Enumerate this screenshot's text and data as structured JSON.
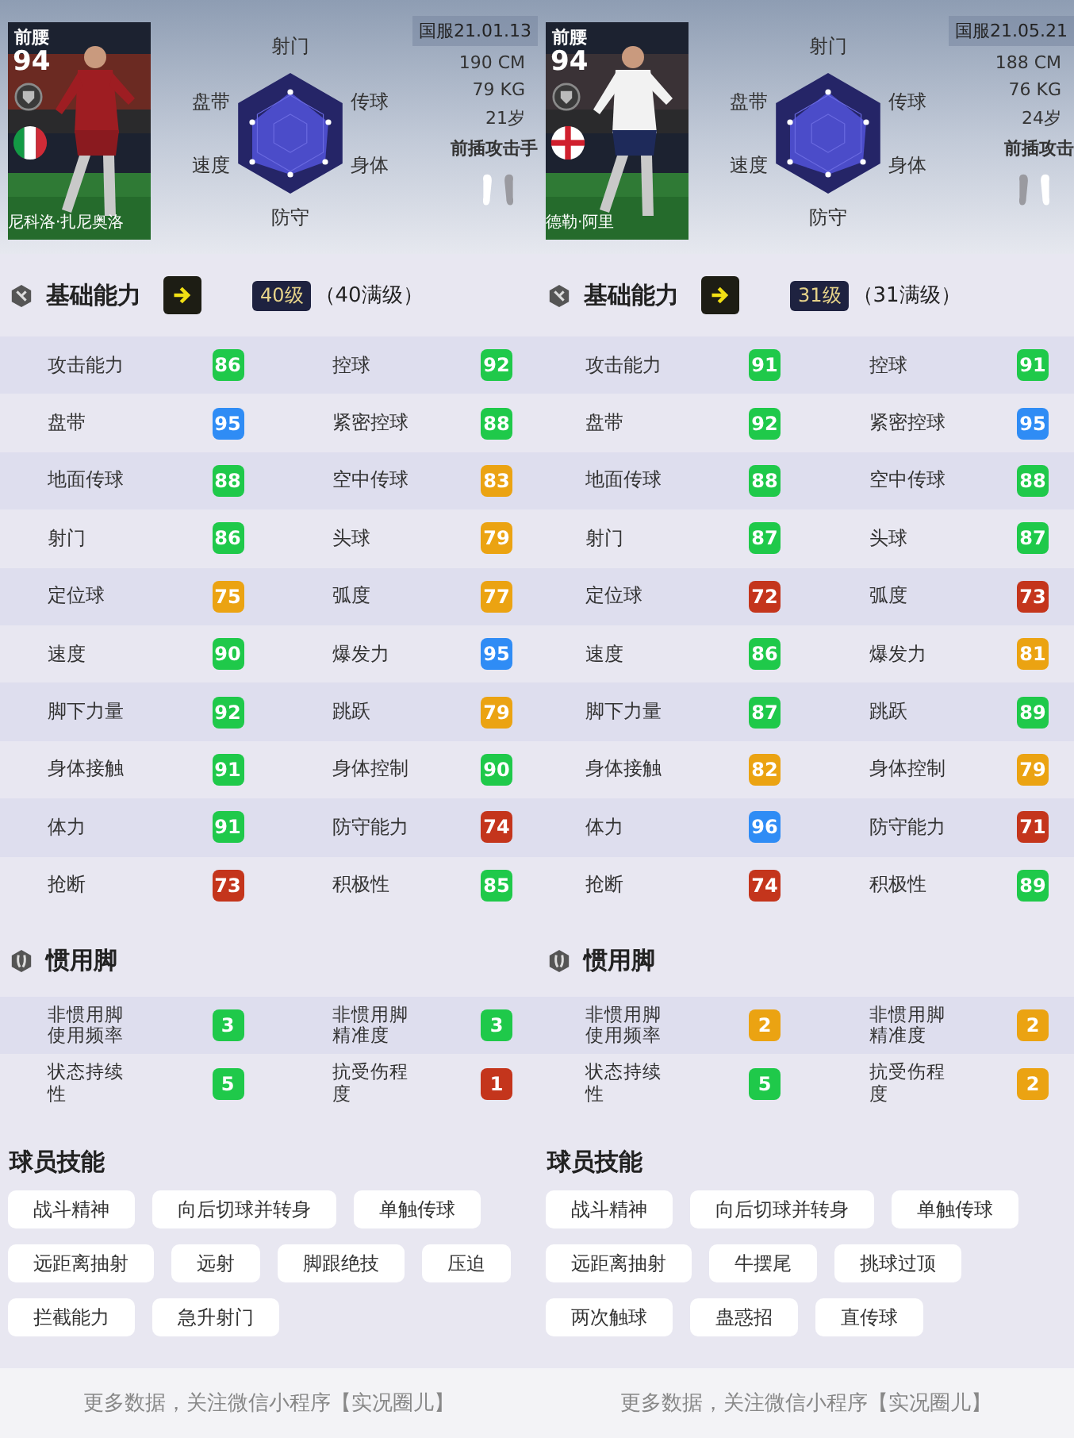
{
  "players": [
    {
      "position": "前腰",
      "rating": "94",
      "name": "尼科洛·扎尼奥洛",
      "flag": {
        "kind": "tricolor"
      },
      "server_date": "国服21.01.13",
      "height": "190 CM",
      "weight": "79 KG",
      "age": "21岁",
      "style": "前插攻击手",
      "feet": {
        "left_strong": true,
        "right_strong": false
      },
      "radar_labels": [
        "射门",
        "盘带",
        "传球",
        "速度",
        "身体",
        "防守"
      ],
      "section_title": "基础能力",
      "grade_badge": "40级",
      "grade_note": "（40满级）",
      "attributes": [
        {
          "label": "攻击能力",
          "value": "86",
          "color": "#1fc94a"
        },
        {
          "label": "控球",
          "value": "92",
          "color": "#1fc94a"
        },
        {
          "label": "盘带",
          "value": "95",
          "color": "#2f8cf5"
        },
        {
          "label": "紧密控球",
          "value": "88",
          "color": "#1fc94a"
        },
        {
          "label": "地面传球",
          "value": "88",
          "color": "#1fc94a"
        },
        {
          "label": "空中传球",
          "value": "83",
          "color": "#eba312"
        },
        {
          "label": "射门",
          "value": "86",
          "color": "#1fc94a"
        },
        {
          "label": "头球",
          "value": "79",
          "color": "#eba312"
        },
        {
          "label": "定位球",
          "value": "75",
          "color": "#eba312"
        },
        {
          "label": "弧度",
          "value": "77",
          "color": "#eba312"
        },
        {
          "label": "速度",
          "value": "90",
          "color": "#1fc94a"
        },
        {
          "label": "爆发力",
          "value": "95",
          "color": "#2f8cf5"
        },
        {
          "label": "脚下力量",
          "value": "92",
          "color": "#1fc94a"
        },
        {
          "label": "跳跃",
          "value": "79",
          "color": "#eba312"
        },
        {
          "label": "身体接触",
          "value": "91",
          "color": "#1fc94a"
        },
        {
          "label": "身体控制",
          "value": "90",
          "color": "#1fc94a"
        },
        {
          "label": "体力",
          "value": "91",
          "color": "#1fc94a"
        },
        {
          "label": "防守能力",
          "value": "74",
          "color": "#c4351c"
        },
        {
          "label": "抢断",
          "value": "73",
          "color": "#c4351c"
        },
        {
          "label": "积极性",
          "value": "85",
          "color": "#1fc94a"
        }
      ],
      "foot_title": "惯用脚",
      "foot_stats": [
        {
          "label": "非惯用脚使用频率",
          "value": "3",
          "color": "#1fc94a"
        },
        {
          "label": "非惯用脚精准度",
          "value": "3",
          "color": "#1fc94a"
        },
        {
          "label": "状态持续性",
          "value": "5",
          "color": "#1fc94a"
        },
        {
          "label": "抗受伤程度",
          "value": "1",
          "color": "#c4351c"
        }
      ],
      "skills_title": "球员技能",
      "skills": [
        "战斗精神",
        "向后切球并转身",
        "单触传球",
        "远距离抽射",
        "远射",
        "脚跟绝技",
        "压迫",
        "拦截能力",
        "急升射门"
      ],
      "footer": "更多数据，关注微信小程序【实况圈儿】"
    },
    {
      "position": "前腰",
      "rating": "94",
      "name": "德勒·阿里",
      "flag": {
        "kind": "cross"
      },
      "server_date": "国服21.05.21",
      "height": "188 CM",
      "weight": "76 KG",
      "age": "24岁",
      "style": "前插攻击",
      "feet": {
        "left_strong": false,
        "right_strong": true
      },
      "radar_labels": [
        "射门",
        "盘带",
        "传球",
        "速度",
        "身体",
        "防守"
      ],
      "section_title": "基础能力",
      "grade_badge": "31级",
      "grade_note": "（31满级）",
      "attributes": [
        {
          "label": "攻击能力",
          "value": "91",
          "color": "#1fc94a"
        },
        {
          "label": "控球",
          "value": "91",
          "color": "#1fc94a"
        },
        {
          "label": "盘带",
          "value": "92",
          "color": "#1fc94a"
        },
        {
          "label": "紧密控球",
          "value": "95",
          "color": "#2f8cf5"
        },
        {
          "label": "地面传球",
          "value": "88",
          "color": "#1fc94a"
        },
        {
          "label": "空中传球",
          "value": "88",
          "color": "#1fc94a"
        },
        {
          "label": "射门",
          "value": "87",
          "color": "#1fc94a"
        },
        {
          "label": "头球",
          "value": "87",
          "color": "#1fc94a"
        },
        {
          "label": "定位球",
          "value": "72",
          "color": "#c4351c"
        },
        {
          "label": "弧度",
          "value": "73",
          "color": "#c4351c"
        },
        {
          "label": "速度",
          "value": "86",
          "color": "#1fc94a"
        },
        {
          "label": "爆发力",
          "value": "81",
          "color": "#eba312"
        },
        {
          "label": "脚下力量",
          "value": "87",
          "color": "#1fc94a"
        },
        {
          "label": "跳跃",
          "value": "89",
          "color": "#1fc94a"
        },
        {
          "label": "身体接触",
          "value": "82",
          "color": "#eba312"
        },
        {
          "label": "身体控制",
          "value": "79",
          "color": "#eba312"
        },
        {
          "label": "体力",
          "value": "96",
          "color": "#2f8cf5"
        },
        {
          "label": "防守能力",
          "value": "71",
          "color": "#c4351c"
        },
        {
          "label": "抢断",
          "value": "74",
          "color": "#c4351c"
        },
        {
          "label": "积极性",
          "value": "89",
          "color": "#1fc94a"
        }
      ],
      "foot_title": "惯用脚",
      "foot_stats": [
        {
          "label": "非惯用脚使用频率",
          "value": "2",
          "color": "#eba312"
        },
        {
          "label": "非惯用脚精准度",
          "value": "2",
          "color": "#eba312"
        },
        {
          "label": "状态持续性",
          "value": "5",
          "color": "#1fc94a"
        },
        {
          "label": "抗受伤程度",
          "value": "2",
          "color": "#eba312"
        }
      ],
      "skills_title": "球员技能",
      "skills": [
        "战斗精神",
        "向后切球并转身",
        "单触传球",
        "远距离抽射",
        "牛摆尾",
        "挑球过顶",
        "两次触球",
        "蛊惑招",
        "直传球"
      ],
      "footer": "更多数据，关注微信小程序【实况圈儿】"
    }
  ]
}
